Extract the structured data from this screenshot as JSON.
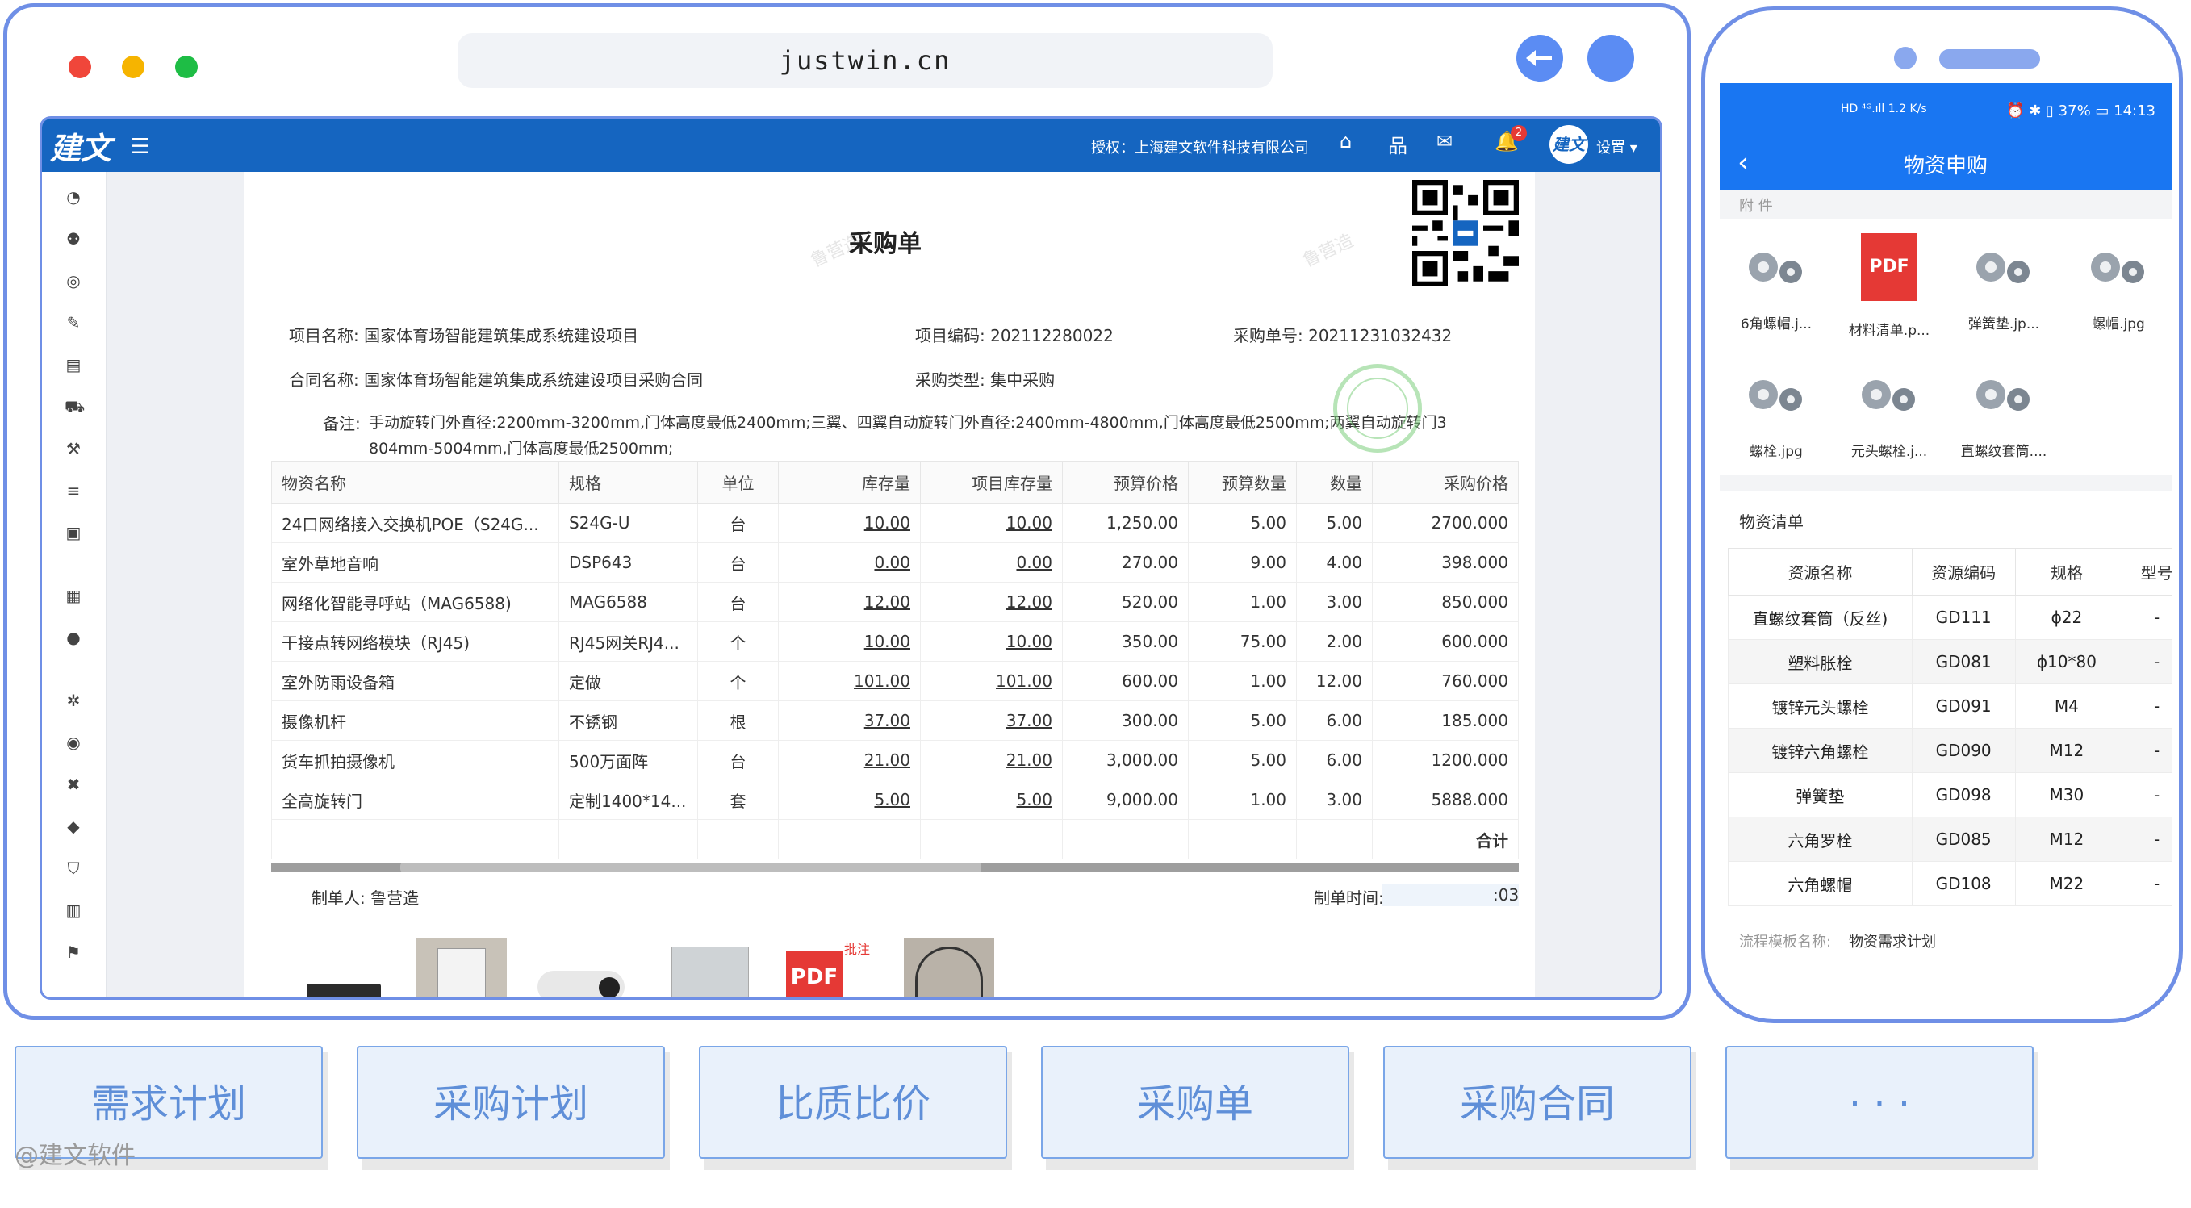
{
  "browser": {
    "url": "justwin.cn",
    "dots": [
      "#f0463a",
      "#f6b400",
      "#1ebd45"
    ]
  },
  "app": {
    "logo": "建文",
    "menu_icon": "menu-icon",
    "auth_text": "授权：上海建文软件科技有限公司",
    "notification_count": "2",
    "avatar_text": "建文",
    "settings_label": "设置 ▾",
    "accent": "#1565c0"
  },
  "doc": {
    "title": "采购单",
    "fields": {
      "project_name": "项目名称: 国家体育场智能建筑集成系统建设项目",
      "project_code": "项目编码: 202112280022",
      "purchase_no": "采购单号: 20211231032432",
      "contract_name": "合同名称: 国家体育场智能建筑集成系统建设项目采购合同",
      "purchase_type": "采购类型: 集中采购",
      "remark_label": "备注:",
      "remark_line1": "手动旋转门外直径:2200mm-3200mm,门体高度最低2400mm;三翼、四翼自动旋转门外直径:2400mm-4800mm,门体高度最低2500mm;两翼自动旋转门3",
      "remark_line2": "804mm-5004mm,门体高度最低2500mm;"
    },
    "columns": [
      "物资名称",
      "规格",
      "单位",
      "库存量",
      "项目库存量",
      "预算价格",
      "预算数量",
      "数量",
      "采购价格"
    ],
    "rows": [
      [
        "24口网络接入交换机POE（S24G...",
        "S24G-U",
        "台",
        "10.00",
        "10.00",
        "1,250.00",
        "5.00",
        "5.00",
        "2700.000"
      ],
      [
        "室外草地音响",
        "DSP643",
        "台",
        "0.00",
        "0.00",
        "270.00",
        "9.00",
        "4.00",
        "398.000"
      ],
      [
        "网络化智能寻呼站（MAG6588)",
        "MAG6588",
        "台",
        "12.00",
        "12.00",
        "520.00",
        "1.00",
        "3.00",
        "850.000"
      ],
      [
        "干接点转网络模块（RJ45)",
        "RJ45网关RJ4...",
        "个",
        "10.00",
        "10.00",
        "350.00",
        "75.00",
        "2.00",
        "600.000"
      ],
      [
        "室外防雨设备箱",
        "定做",
        "个",
        "101.00",
        "101.00",
        "600.00",
        "1.00",
        "12.00",
        "760.000"
      ],
      [
        "摄像机杆",
        "不锈钢",
        "根",
        "37.00",
        "37.00",
        "300.00",
        "5.00",
        "6.00",
        "185.000"
      ],
      [
        "货车抓拍摄像机",
        "500万面阵",
        "台",
        "21.00",
        "21.00",
        "3,000.00",
        "5.00",
        "6.00",
        "1200.000"
      ],
      [
        "全高旋转门",
        "定制1400*14...",
        "套",
        "5.00",
        "5.00",
        "9,000.00",
        "1.00",
        "3.00",
        "5888.000"
      ]
    ],
    "total_label": "合计",
    "maker": "制单人: 鲁营造",
    "make_time_label": "制单时间:",
    "make_time_tail": ":03",
    "pdf_label": "PDF",
    "pdf_stamp": "批注"
  },
  "phone": {
    "status_right": "⏰ ✱ ▯ 37% ▭ 14:13",
    "status_left": "HD ⁴ᴳ.ıll 1.2 K/s",
    "title": "物资申购",
    "attachments_label": "附 件",
    "attachments": [
      {
        "name": "6角螺帽.j...",
        "icon": "nuts-image-icon"
      },
      {
        "name": "材料清单.p...",
        "icon": "pdf-file-icon"
      },
      {
        "name": "弹簧垫.jp...",
        "icon": "washer-image-icon"
      },
      {
        "name": "螺帽.jpg",
        "icon": "nut-image-icon"
      },
      {
        "name": "螺栓.jpg",
        "icon": "bolt-image-icon"
      },
      {
        "name": "元头螺栓.j...",
        "icon": "roundhead-bolt-image-icon"
      },
      {
        "name": "直螺纹套筒....",
        "icon": "sleeve-image-icon"
      }
    ],
    "pdf_label": "PDF",
    "list_label": "物资清单",
    "columns": [
      "资源名称",
      "资源编码",
      "规格",
      "型号"
    ],
    "rows": [
      [
        "直螺纹套筒（反丝)",
        "GD111",
        "ϕ22",
        "-"
      ],
      [
        "塑料胀栓",
        "GD081",
        "ϕ10*80",
        "-"
      ],
      [
        "镀锌元头螺栓",
        "GD091",
        "M4",
        "-"
      ],
      [
        "镀锌六角螺栓",
        "GD090",
        "M12",
        "-"
      ],
      [
        "弹簧垫",
        "GD098",
        "M30",
        "-"
      ],
      [
        "六角罗栓",
        "GD085",
        "M12",
        "-"
      ],
      [
        "六角螺帽",
        "GD108",
        "M22",
        "-"
      ]
    ],
    "flow_label": "流程模板名称:",
    "flow_value": "物资需求计划"
  },
  "tabs": [
    "需求计划",
    "采购计划",
    "比质比价",
    "采购单",
    "采购合同",
    "· · ·"
  ],
  "watermark": "@建文软件"
}
